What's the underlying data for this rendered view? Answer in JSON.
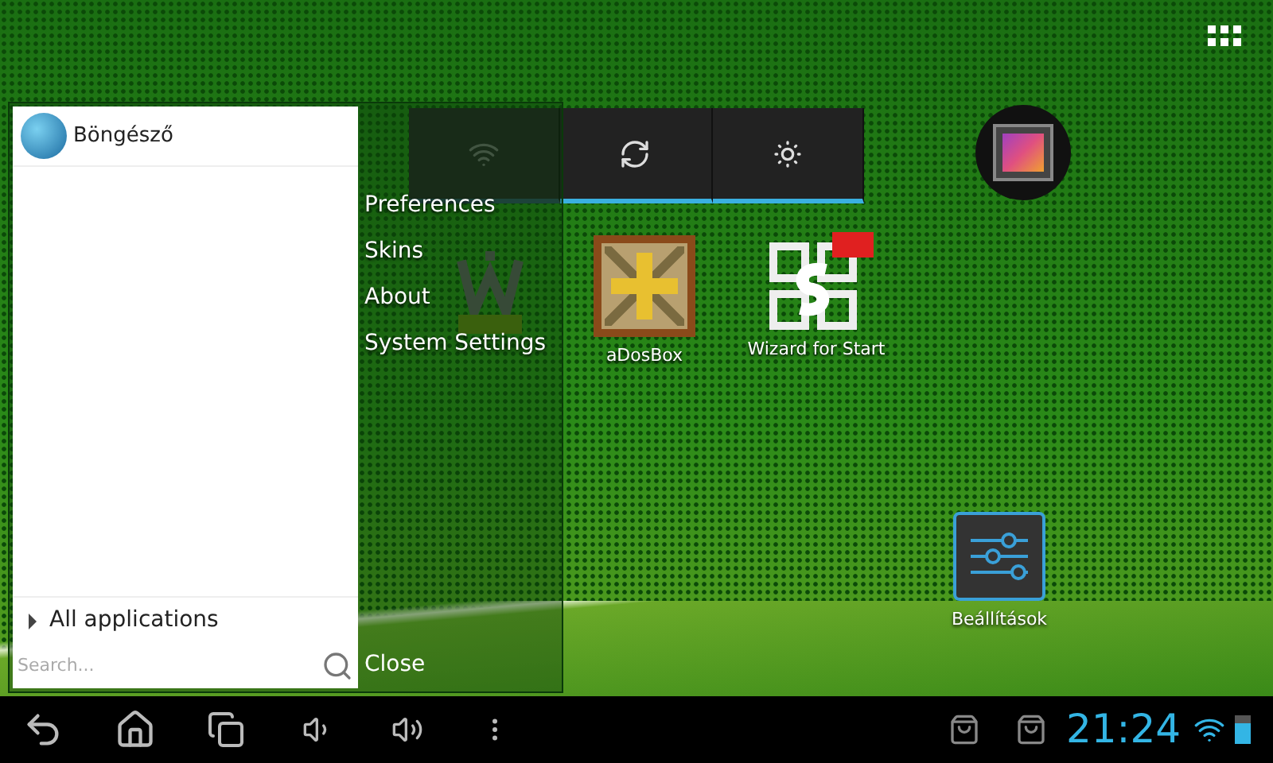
{
  "menu": {
    "pinned_apps": [
      {
        "label": "Böngésző"
      }
    ],
    "all_apps": "All applications",
    "search": {
      "placeholder": "Search..."
    },
    "options": [
      "Preferences",
      "Skins",
      "About",
      "System Settings"
    ],
    "close": "Close"
  },
  "toggle_widget": [
    {
      "kind": "wifi",
      "on": false
    },
    {
      "kind": "sync",
      "on": true
    },
    {
      "kind": "brightness",
      "on": true
    }
  ],
  "desktop_icons": [
    {
      "kind": "beta"
    },
    {
      "kind": "dosbox",
      "label": "aDosBox"
    },
    {
      "kind": "wizard",
      "label": "Wizard for Start"
    },
    {
      "kind": "gallery"
    },
    {
      "kind": "settings",
      "label": "Beállítások"
    }
  ],
  "status_bar": {
    "clock": "21:24"
  }
}
